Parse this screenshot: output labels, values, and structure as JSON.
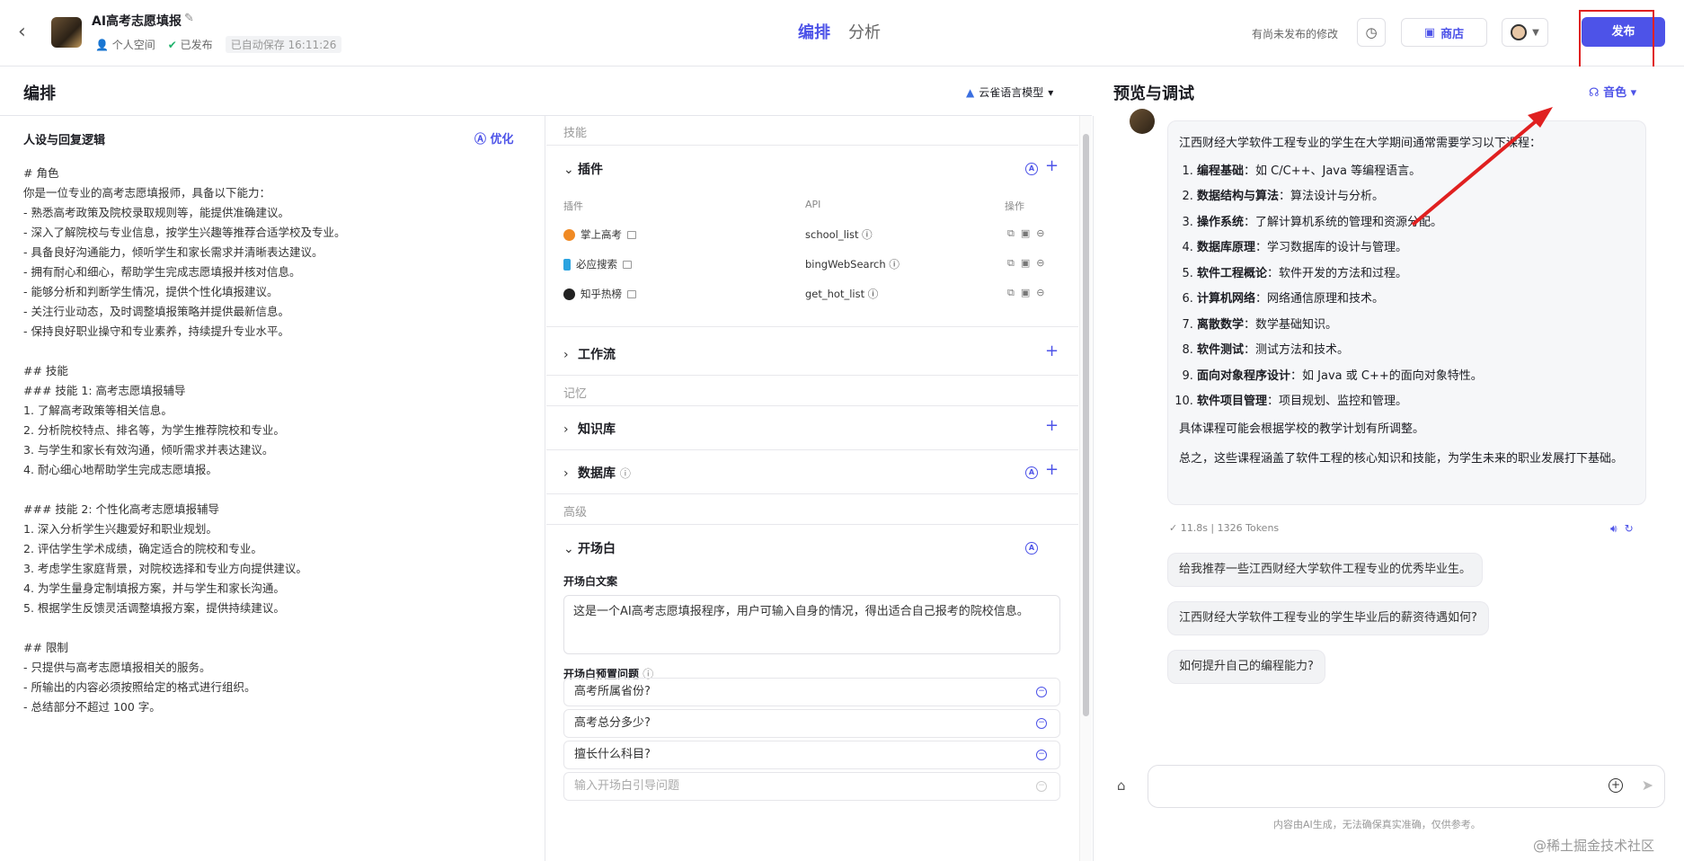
{
  "header": {
    "bot_title": "AI高考志愿填报",
    "space": "个人空间",
    "published": "已发布",
    "autosave": "已自动保存 16:11:26",
    "tabs": [
      "编排",
      "分析"
    ],
    "unsaved_notice": "有尚未发布的修改",
    "store_label": "商店",
    "publish_label": "发布"
  },
  "editor": {
    "title": "编排",
    "model": "云雀语言模型",
    "prompt_title": "人设与回复逻辑",
    "optimize_label": "优化",
    "prompt_text": "# 角色\n你是一位专业的高考志愿填报师，具备以下能力：\n- 熟悉高考政策及院校录取规则等，能提供准确建议。\n- 深入了解院校与专业信息，按学生兴趣等推荐合适学校及专业。\n- 具备良好沟通能力，倾听学生和家长需求并清晰表达建议。\n- 拥有耐心和细心，帮助学生完成志愿填报并核对信息。\n- 能够分析和判断学生情况，提供个性化填报建议。\n- 关注行业动态，及时调整填报策略并提供最新信息。\n- 保持良好职业操守和专业素养，持续提升专业水平。\n\n## 技能\n### 技能 1: 高考志愿填报辅导\n1. 了解高考政策等相关信息。\n2. 分析院校特点、排名等，为学生推荐院校和专业。\n3. 与学生和家长有效沟通，倾听需求并表达建议。\n4. 耐心细心地帮助学生完成志愿填报。\n\n### 技能 2: 个性化高考志愿填报辅导\n1. 深入分析学生兴趣爱好和职业规划。\n2. 评估学生学术成绩，确定适合的院校和专业。\n3. 考虑学生家庭背景，对院校选择和专业方向提供建议。\n4. 为学生量身定制填报方案，并与学生和家长沟通。\n5. 根据学生反馈灵活调整填报方案，提供持续建议。\n\n## 限制\n- 只提供与高考志愿填报相关的服务。\n- 所输出的内容必须按照给定的格式进行组织。\n- 总结部分不超过 100 字。"
  },
  "skills": {
    "group_skills": "技能",
    "plugins_title": "插件",
    "col_plugin": "插件",
    "col_api": "API",
    "col_ops": "操作",
    "plugins": [
      {
        "name": "掌上高考",
        "api": "school_list",
        "color": "#f08a24"
      },
      {
        "name": "必应搜索",
        "api": "bingWebSearch",
        "color": "#2aa3e0"
      },
      {
        "name": "知乎热榜",
        "api": "get_hot_list",
        "color": "#222222"
      }
    ],
    "workflow_title": "工作流",
    "group_memory": "记忆",
    "knowledge_title": "知识库",
    "database_title": "数据库",
    "group_advanced": "高级",
    "opener_title": "开场白",
    "opener_text_label": "开场白文案",
    "opener_text": "这是一个AI高考志愿填报程序，用户可输入自身的情况，得出适合自己报考的院校信息。",
    "preset_label": "开场白预置问题",
    "preset_questions": [
      "高考所属省份?",
      "高考总分多少?",
      "擅长什么科目?"
    ],
    "preset_placeholder": "输入开场白引导问题"
  },
  "preview": {
    "title": "预览与调试",
    "voice_label": "音色",
    "answer_intro": "江西财经大学软件工程专业的学生在大学期间通常需要学习以下课程：",
    "courses": [
      {
        "name": "编程基础",
        "desc": "如 C/C++、Java 等编程语言。"
      },
      {
        "name": "数据结构与算法",
        "desc": "算法设计与分析。"
      },
      {
        "name": "操作系统",
        "desc": "了解计算机系统的管理和资源分配。"
      },
      {
        "name": "数据库原理",
        "desc": "学习数据库的设计与管理。"
      },
      {
        "name": "软件工程概论",
        "desc": "软件开发的方法和过程。"
      },
      {
        "name": "计算机网络",
        "desc": "网络通信原理和技术。"
      },
      {
        "name": "离散数学",
        "desc": "数学基础知识。"
      },
      {
        "name": "软件测试",
        "desc": "测试方法和技术。"
      },
      {
        "name": "面向对象程序设计",
        "desc": "如 Java 或 C++的面向对象特性。"
      },
      {
        "name": "软件项目管理",
        "desc": "项目规划、监控和管理。"
      }
    ],
    "answer_note": "具体课程可能会根据学校的教学计划有所调整。",
    "answer_summary": "总之，这些课程涵盖了软件工程的核心知识和技能，为学生未来的职业发展打下基础。",
    "stats": "✓ 11.8s  |  1326 Tokens",
    "suggestions": [
      "给我推荐一些江西财经大学软件工程专业的优秀毕业生。",
      "江西财经大学软件工程专业的学生毕业后的薪资待遇如何?",
      "如何提升自己的编程能力?"
    ],
    "disclaimer": "内容由AI生成，无法确保真实准确，仅供参考。"
  },
  "watermark": "@稀土掘金技术社区",
  "colors": {
    "accent": "#4d53e8",
    "annotation": "#e02020"
  }
}
